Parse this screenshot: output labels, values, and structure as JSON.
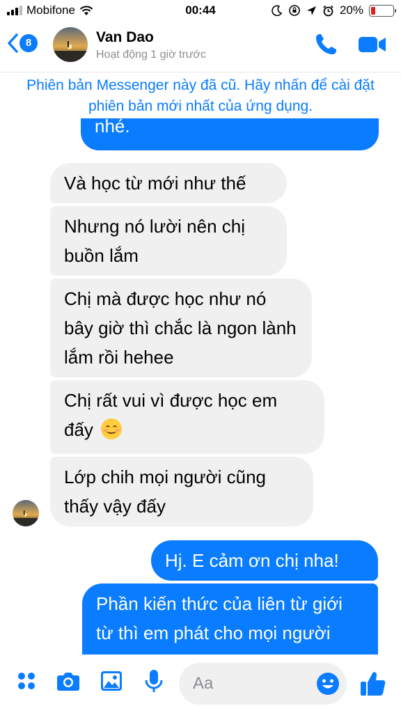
{
  "status_bar": {
    "carrier": "Mobifone",
    "time": "00:44",
    "battery_percent": "20%",
    "battery_level": 0.2
  },
  "header": {
    "unread_badge": "8",
    "contact_name": "Van Dao",
    "contact_status": "Hoạt động 1 giờ trước"
  },
  "banner": {
    "text": "Phiên bản Messenger này đã cũ. Hãy nhấn để cài đặt phiên bản mới nhất của ứng dụng."
  },
  "messages": [
    {
      "direction": "outgoing",
      "text": "nhé."
    },
    {
      "direction": "incoming",
      "text": "Và học từ mới như thế"
    },
    {
      "direction": "incoming",
      "text": "Nhưng nó lười nên chị buồn lắm"
    },
    {
      "direction": "incoming",
      "text": "Chị mà được học như nó bây giờ thì chắc là ngon lành lắm rồi hehee"
    },
    {
      "direction": "incoming",
      "text": "Chị rất vui vì được học em đấy",
      "emoji": "smiling-face"
    },
    {
      "direction": "incoming",
      "text": "Lớp chih mọi người cũng thấy vậy đấy"
    },
    {
      "direction": "outgoing",
      "text": "Hj. E cảm ơn chị nha!"
    },
    {
      "direction": "outgoing",
      "text": "Phần kiến thức của liên từ giới từ thì em phát cho mọi người đấy. Còn bài tập thì"
    }
  ],
  "composer": {
    "placeholder": "Aa"
  },
  "colors": {
    "accent": "#0a7cff",
    "incoming_bubble": "#f0f0f0"
  },
  "icons": [
    "back-chevron-icon",
    "phone-icon",
    "video-camera-icon",
    "menu-dots-icon",
    "camera-icon",
    "photo-icon",
    "microphone-icon",
    "emoji-icon",
    "thumbs-up-icon"
  ]
}
